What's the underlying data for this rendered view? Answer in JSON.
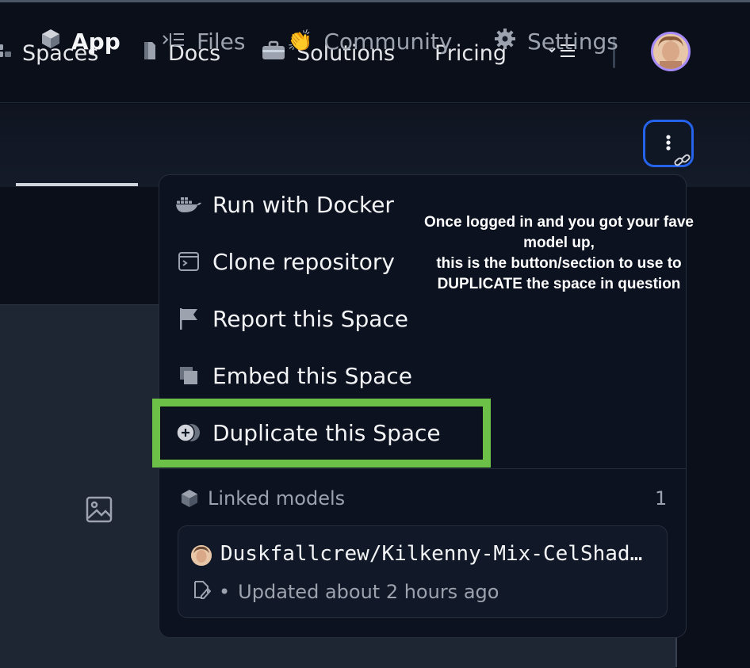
{
  "topnav": {
    "items": [
      {
        "label": "Spaces",
        "icon": "spaces-icon"
      },
      {
        "label": "Docs",
        "icon": "docs-icon"
      },
      {
        "label": "Solutions",
        "icon": "briefcase-icon"
      },
      {
        "label": "Pricing"
      }
    ],
    "more_icon": "chevron-menu-icon"
  },
  "tabs": [
    {
      "label": "App",
      "icon": "cube-icon",
      "active": true
    },
    {
      "label": "Files",
      "icon": "files-icon"
    },
    {
      "label": "Community",
      "icon": "clap-emoji-icon",
      "emoji": "👏"
    },
    {
      "label": "Settings",
      "icon": "gear-icon"
    }
  ],
  "menu": {
    "items": [
      {
        "label": "Run with Docker",
        "icon": "docker-icon"
      },
      {
        "label": "Clone repository",
        "icon": "terminal-icon"
      },
      {
        "label": "Report this Space",
        "icon": "flag-icon"
      },
      {
        "label": "Embed this Space",
        "icon": "embed-icon"
      },
      {
        "label": "Duplicate this Space",
        "icon": "duplicate-icon"
      }
    ],
    "linked_models": {
      "label": "Linked models",
      "count": "1",
      "model": {
        "name": "Duskfallcrew/Kilkenny-Mix-CelShaded",
        "meta_separator": "•",
        "updated": "Updated about 2 hours ago"
      }
    }
  },
  "annotation": {
    "text": "Once logged in and you got your fave\nmodel up,\nthis is the button/section to use to\nDUPLICATE the space in question"
  },
  "colors": {
    "highlight": "#6cbf47",
    "focus_ring": "#2563eb",
    "avatar_ring": "#a78bfa"
  }
}
